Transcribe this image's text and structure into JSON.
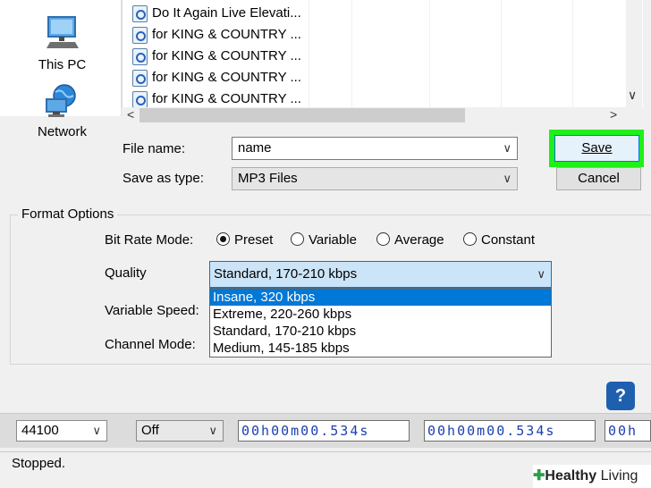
{
  "nav": {
    "this_pc": "This PC",
    "network": "Network"
  },
  "files": [
    "Do It Again Live Elevati...",
    "for KING & COUNTRY ...",
    "for KING & COUNTRY ...",
    "for KING & COUNTRY ...",
    "for KING & COUNTRY ..."
  ],
  "scroll": {
    "left": "<",
    "right": ">",
    "down": "∨"
  },
  "save_form": {
    "file_name_label": "File name:",
    "file_name_value": "name",
    "save_as_type_label": "Save as type:",
    "save_as_type_value": "MP3 Files",
    "save_button": "Save",
    "cancel_button": "Cancel"
  },
  "format_options": {
    "title": "Format Options",
    "bit_rate_mode_label": "Bit Rate Mode:",
    "modes": [
      "Preset",
      "Variable",
      "Average",
      "Constant"
    ],
    "selected_mode": "Preset",
    "quality_label": "Quality",
    "quality_value": "Standard, 170-210 kbps",
    "quality_options": [
      "Insane, 320 kbps",
      "Extreme, 220-260 kbps",
      "Standard, 170-210 kbps",
      "Medium, 145-185 kbps"
    ],
    "highlighted_option": "Insane, 320 kbps",
    "variable_speed_label": "Variable Speed:",
    "channel_mode_label": "Channel Mode:"
  },
  "help_button": "?",
  "toolbar": {
    "rate": "44100",
    "snap": "Off",
    "time1": "00h00m00.534s",
    "time2": "00h00m00.534s",
    "time3": "00h"
  },
  "status": "Stopped.",
  "watermark": {
    "brand_bold": "Healthy",
    "brand_rest": " Living"
  },
  "colors": {
    "highlight_green": "#1ef018",
    "selection_blue": "#0078d7",
    "help_blue": "#1f5faf"
  }
}
